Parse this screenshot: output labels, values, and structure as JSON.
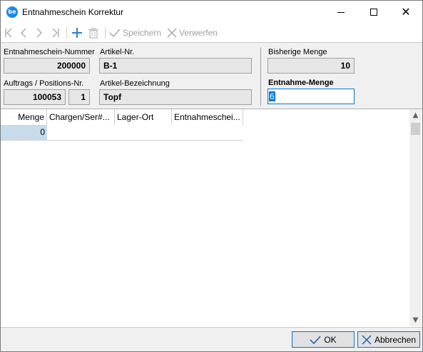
{
  "window": {
    "title": "Entnahmeschein Korrektur",
    "app_icon_text": "be"
  },
  "toolbar": {
    "first_icon": "first-record-icon",
    "prev_icon": "previous-record-icon",
    "next_icon": "next-record-icon",
    "last_icon": "last-record-icon",
    "add_icon": "add-icon",
    "delete_icon": "delete-icon",
    "save_label": "Speichern",
    "discard_label": "Verwerfen"
  },
  "form": {
    "entnahmeschein_nummer": {
      "label": "Entnahmeschein-Nummer",
      "value": "200000"
    },
    "artikel_nr": {
      "label": "Artikel-Nr.",
      "value": "B-1"
    },
    "auftrags_positions": {
      "label": "Auftrags / Positions-Nr.",
      "auftrag": "100053",
      "position": "1"
    },
    "artikel_bezeichnung": {
      "label": "Artikel-Bezeichnung",
      "value": "Topf"
    },
    "bisherige_menge": {
      "label": "Bisherige Menge",
      "value": "10"
    },
    "entnahme_menge": {
      "label": "Entnahme-Menge",
      "value": "6"
    }
  },
  "grid": {
    "columns": [
      "Menge",
      "Chargen/Ser#...",
      "Lager-Ort",
      "Entnahmeschei..."
    ],
    "rows": [
      [
        "0",
        "",
        "",
        ""
      ]
    ]
  },
  "footer": {
    "ok_label": "OK",
    "cancel_label": "Abbrechen"
  },
  "colors": {
    "accent": "#0078d7",
    "app_icon": "#1e88e5",
    "form_bg": "#f0f0f0",
    "readonly_field": "#e6e6e6",
    "selected_cell": "#c8dbe8"
  }
}
